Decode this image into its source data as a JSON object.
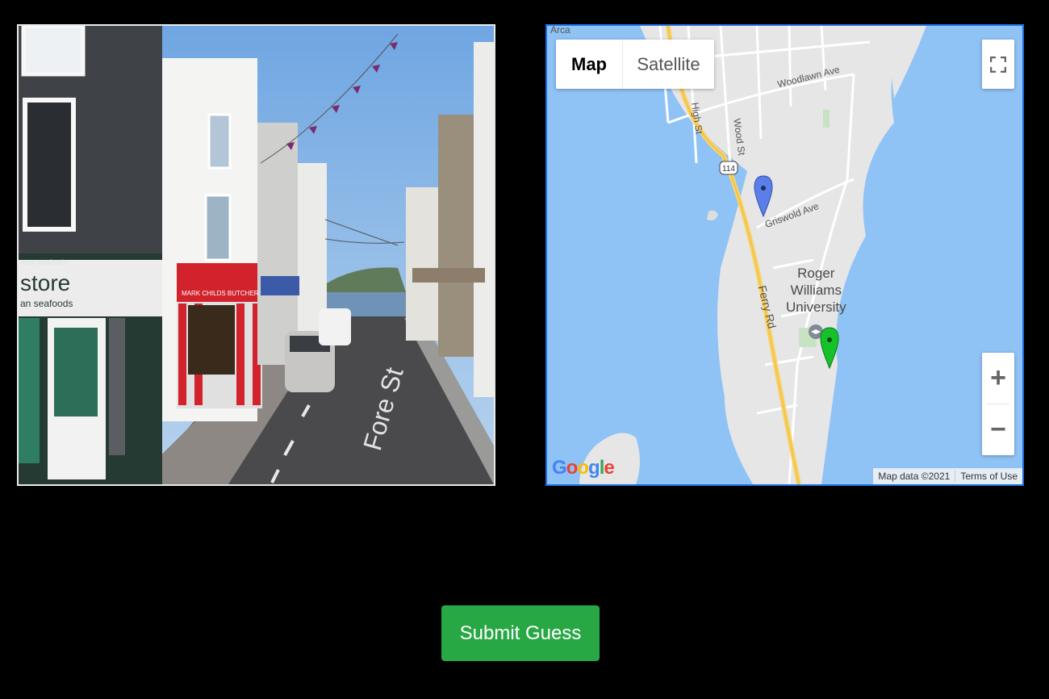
{
  "street_view": {
    "shop_sign_left": "store",
    "shop_sign_left_small": "an seafoods",
    "shop_awning_top": "ozen  seafoods",
    "shop_sign_red": "MARK CHILDS BUTCHER",
    "road_marking": "Fore St"
  },
  "map": {
    "map_type_options": [
      "Map",
      "Satellite"
    ],
    "selected_map_type": "Map",
    "top_label": "Arca",
    "streets": {
      "woodlawn": "Woodlawn Ave",
      "high": "High St",
      "wood": "Wood St",
      "griswold": "Griswold Ave",
      "ferry": "Ferry Rd"
    },
    "route_shield": "114",
    "poi_lines": [
      "Roger",
      "Williams",
      "University"
    ],
    "zoom_in_label": "+",
    "zoom_out_label": "−",
    "google_logo": "Google",
    "map_data_text": "Map data ©2021",
    "terms_text": "Terms of Use",
    "guess_pin_color": "#5b7fe8",
    "answer_pin_color": "#16c12a"
  },
  "submit": {
    "label": "Submit Guess",
    "color": "#28a745"
  }
}
